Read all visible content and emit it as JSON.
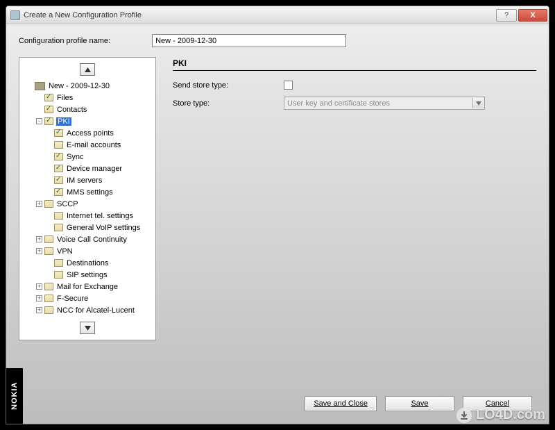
{
  "window": {
    "title": "Create a New Configuration Profile"
  },
  "profile": {
    "name_label": "Configuration profile name:",
    "name_value": "New - 2009-12-30"
  },
  "tree": {
    "root": "New - 2009-12-30",
    "items": [
      {
        "label": "Files",
        "level": 2,
        "checked": true,
        "expand": ""
      },
      {
        "label": "Contacts",
        "level": 2,
        "checked": true,
        "expand": ""
      },
      {
        "label": "PKI",
        "level": 2,
        "checked": true,
        "expand": "-",
        "selected": true
      },
      {
        "label": "Access points",
        "level": 3,
        "checked": true,
        "expand": ""
      },
      {
        "label": "E-mail accounts",
        "level": 3,
        "checked": false,
        "expand": ""
      },
      {
        "label": "Sync",
        "level": 3,
        "checked": true,
        "expand": ""
      },
      {
        "label": "Device manager",
        "level": 3,
        "checked": true,
        "expand": ""
      },
      {
        "label": "IM servers",
        "level": 3,
        "checked": true,
        "expand": ""
      },
      {
        "label": "MMS settings",
        "level": 3,
        "checked": true,
        "expand": ""
      },
      {
        "label": "SCCP",
        "level": 2,
        "checked": false,
        "expand": "+"
      },
      {
        "label": "Internet tel. settings",
        "level": 3,
        "checked": false,
        "expand": ""
      },
      {
        "label": "General VoIP settings",
        "level": 3,
        "checked": false,
        "expand": ""
      },
      {
        "label": "Voice Call Continuity",
        "level": 2,
        "checked": false,
        "expand": "+"
      },
      {
        "label": "VPN",
        "level": 2,
        "checked": false,
        "expand": "+"
      },
      {
        "label": "Destinations",
        "level": 3,
        "checked": false,
        "expand": ""
      },
      {
        "label": "SIP settings",
        "level": 3,
        "checked": false,
        "expand": ""
      },
      {
        "label": "Mail for Exchange",
        "level": 2,
        "checked": false,
        "expand": "+"
      },
      {
        "label": "F-Secure",
        "level": 2,
        "checked": false,
        "expand": "+"
      },
      {
        "label": "NCC for Alcatel-Lucent",
        "level": 2,
        "checked": false,
        "expand": "+"
      }
    ]
  },
  "form": {
    "heading": "PKI",
    "send_store_type_label": "Send store type:",
    "store_type_label": "Store type:",
    "store_type_value": "User key and certificate stores"
  },
  "buttons": {
    "save_and_close": "Save and Close",
    "save": "Save",
    "cancel": "Cancel"
  },
  "brand": "NOKIA",
  "watermark": "LO4D.com"
}
